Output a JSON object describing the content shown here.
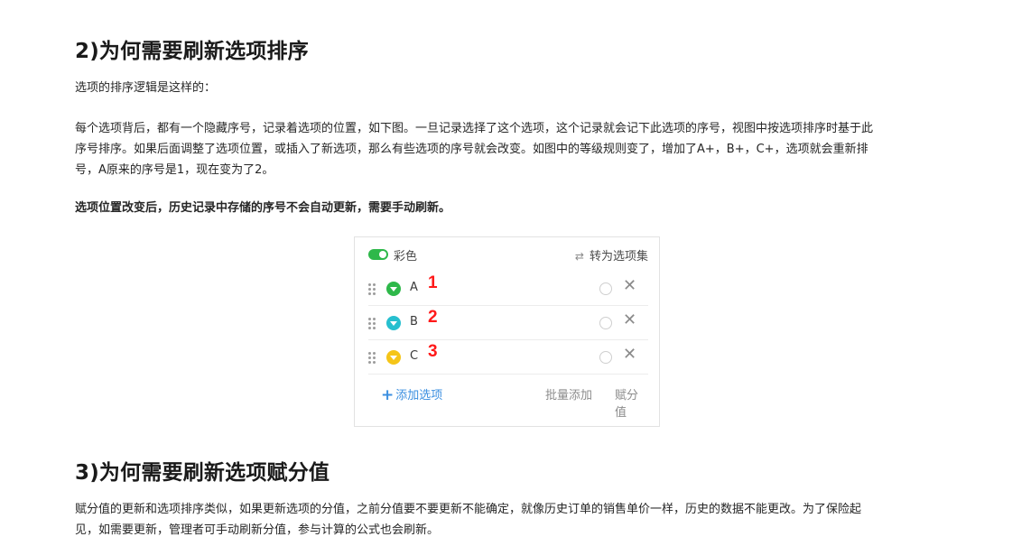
{
  "sections": {
    "s2": {
      "title": "2)为何需要刷新选项排序",
      "intro": "选项的排序逻辑是这样的：",
      "body_lines": [
        "每个选项背后，都有一个隐藏序号，记录着选项的位置，如下图。一旦记录选择了这个选项，这个记录就会记下此选项的序号，视图中按选项排序时基于此",
        "序号排序。如果后面调整了选项位置，或插入了新选项，那么有些选项的序号就会改变。如图中的等级规则变了，增加了A+，B+，C+，选项就会重新排",
        "号，A原来的序号是1，现在变为了2。"
      ],
      "emphasis": "选项位置改变后，历史记录中存储的序号不会自动更新，需要手动刷新。"
    },
    "card": {
      "color_toggle_label": "彩色",
      "color_toggle_on": true,
      "convert_icon": "swap-icon",
      "convert_label": "转为选项集",
      "options": [
        {
          "label": "A",
          "number": "1",
          "color": "#2eb84a"
        },
        {
          "label": "B",
          "number": "2",
          "color": "#26bfcf"
        },
        {
          "label": "C",
          "number": "3",
          "color": "#f5c518"
        }
      ],
      "add_label": "添加选项",
      "batch_add_label": "批量添加",
      "score_label": "赋分值"
    },
    "s3": {
      "title": "3)为何需要刷新选项赋分值",
      "body_lines": [
        "赋分值的更新和选项排序类似，如果更新选项的分值，之前分值要不要更新不能确定，就像历史订单的销售单价一样，历史的数据不能更改。为了保险起",
        "见，如需要更新，管理者可手动刷新分值，参与计算的公式也会刷新。"
      ]
    }
  }
}
